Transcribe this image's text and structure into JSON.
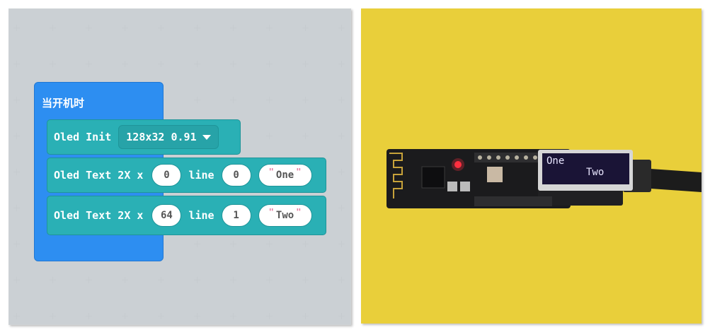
{
  "hat_block": {
    "label": "当开机时"
  },
  "blocks": [
    {
      "label": "Oled Init",
      "dropdown": "128x32 0.91"
    },
    {
      "label": "Oled Text 2X x",
      "x": "0",
      "line_label": "line",
      "line": "0",
      "text": "One"
    },
    {
      "label": "Oled Text 2X x",
      "x": "64",
      "line_label": "line",
      "line": "1",
      "text": "Two"
    }
  ],
  "string_quote_open": "\"",
  "string_quote_close": "\"",
  "oled_display": {
    "line1": "One",
    "line2": "Two"
  },
  "colors": {
    "hat": "#2d8ef1",
    "block": "#2ab0b5",
    "background": "#e6e9ec",
    "photo_background": "#e9cf3a"
  },
  "icons": {
    "dropdown": "caret-down-icon"
  }
}
